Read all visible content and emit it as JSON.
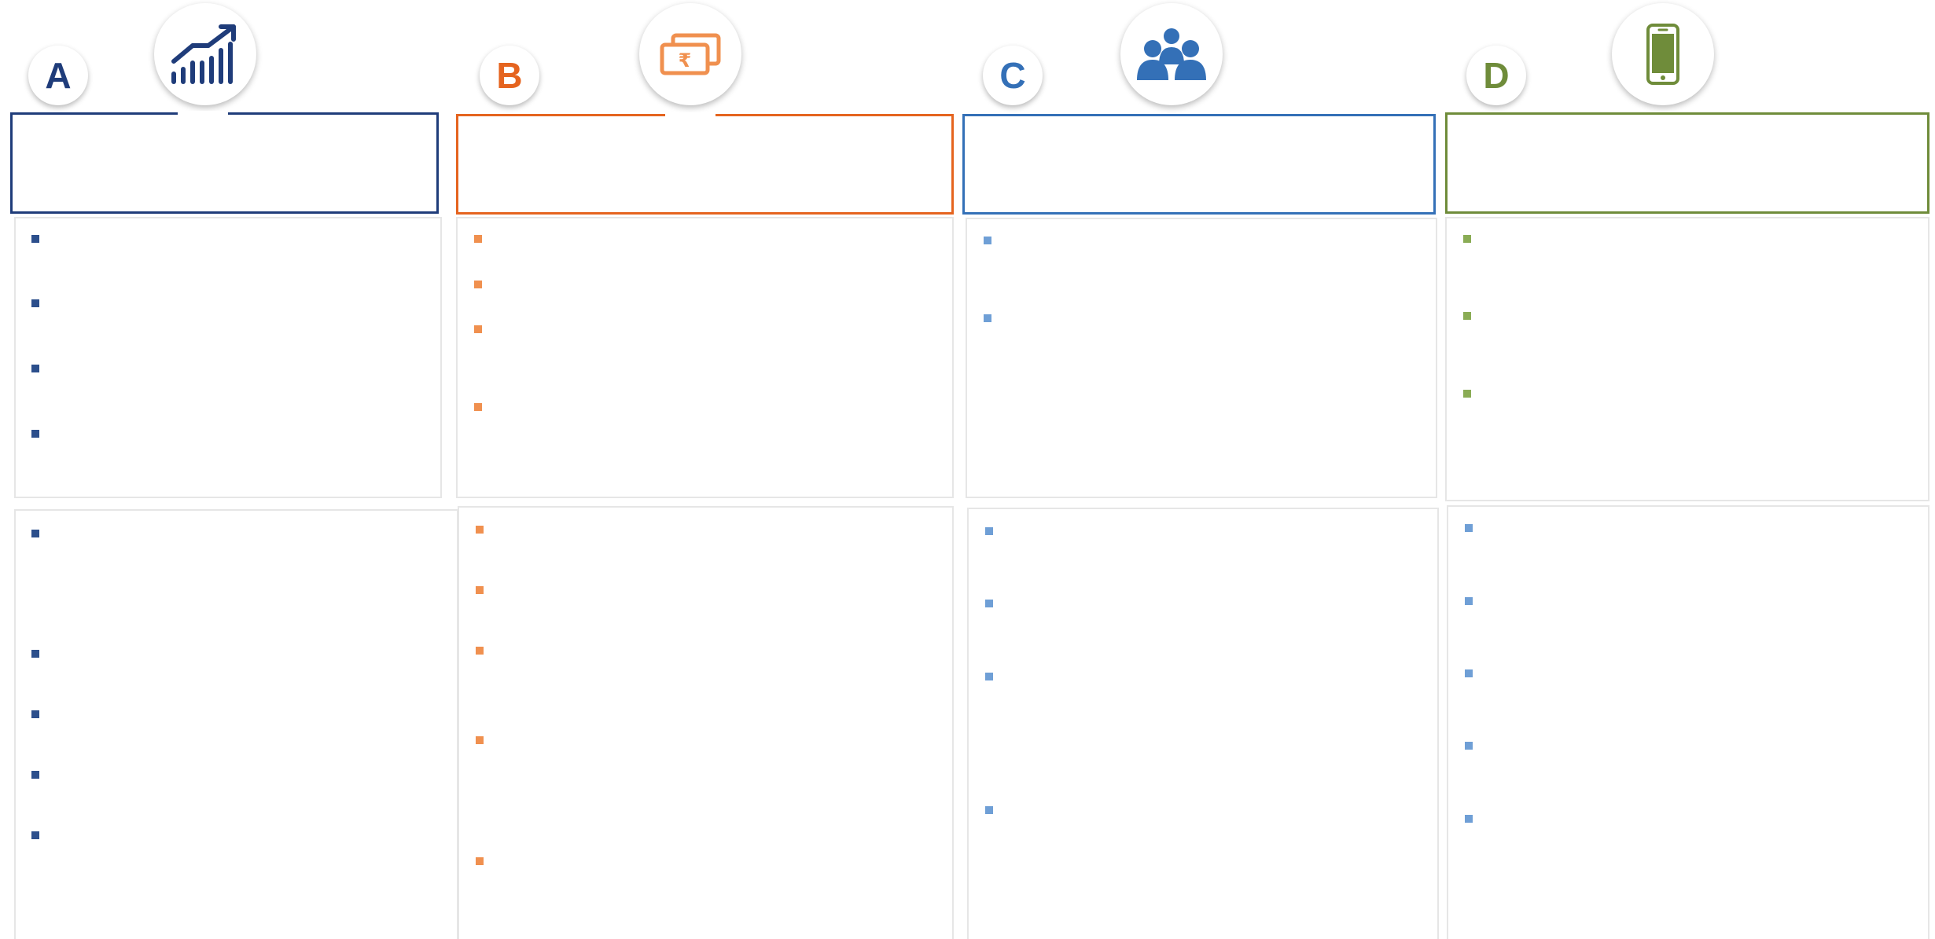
{
  "columns": [
    {
      "letter": "A",
      "color": "#1f3c7a",
      "bullet_color": "#2c4f8c",
      "icon": "growth-chart-icon"
    },
    {
      "letter": "B",
      "color": "#e5641f",
      "bullet_color": "#f0904f",
      "icon": "rupee-notes-icon"
    },
    {
      "letter": "C",
      "color": "#3470b7",
      "bullet_color": "#6f9fd6",
      "icon": "people-group-icon"
    },
    {
      "letter": "D",
      "color": "#6f8c3a",
      "bullet_color": "#8aac55",
      "bullet_color_lower": "#6f9fd6",
      "icon": "mobile-phone-icon"
    }
  ]
}
